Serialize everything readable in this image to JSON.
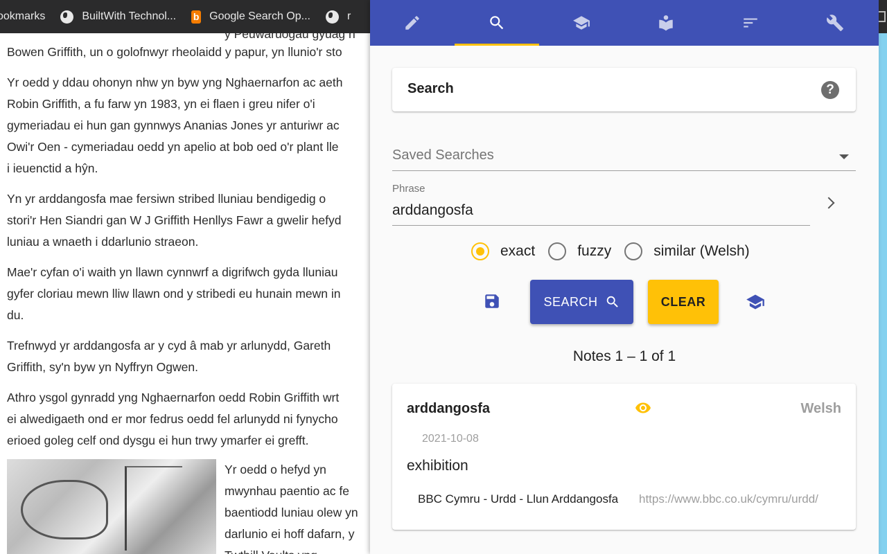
{
  "bookmarks": {
    "items": [
      {
        "label": "ookmarks",
        "icon": "bookmarks-folder"
      },
      {
        "label": "BuiltWith Technol...",
        "icon": "globe-icon"
      },
      {
        "label": "Google Search Op...",
        "icon": "bing-icon"
      },
      {
        "label": "r",
        "icon": "globe-icon"
      }
    ]
  },
  "article": {
    "cut_top": "y Peuwaruogau gyuag n",
    "paragraphs": [
      [
        "Bowen Griffith, un o golofnwyr rheolaidd y papur, yn llunio'r sto"
      ],
      [
        "Yr oedd y ddau ohonyn nhw yn byw yng Nghaernarfon ac aeth",
        "Robin Griffith, a fu farw yn 1983, yn ei flaen i greu nifer o'i",
        "gymeriadau ei hun gan gynnwys Ananias Jones yr anturiwr ac",
        "Owi'r Oen - cymeriadau oedd yn apelio at bob oed o'r plant lle",
        "i ieuenctid a hŷn."
      ],
      [
        "Yn yr arddangosfa mae fersiwn stribed lluniau bendigedig o",
        "stori'r Hen Siandri gan W J Griffith Henllys Fawr a gwelir hefyd",
        "luniau a wnaeth i ddarlunio straeon."
      ],
      [
        "Mae'r cyfan o'i waith yn llawn cynnwrf a digrifwch gyda lluniau",
        "gyfer cloriau mewn lliw llawn ond y stribedi eu hunain mewn in",
        "du."
      ],
      [
        "Trefnwyd yr arddangosfa ar y cyd â mab yr arlunydd, Gareth",
        "Griffith, sy'n byw yn Nyffryn Ogwen."
      ],
      [
        "Athro ysgol gynradd yng Nghaernarfon oedd Robin Griffith wrt",
        "ei alwedigaeth ond er mor fedrus oedd fel arlunydd ni fynycho",
        "erioed goleg celf ond dysgu ei hun trwy ymarfer ei grefft."
      ]
    ],
    "side_lines": [
      "Yr oedd o hefyd yn",
      "mwynhau paentio ac fe",
      "baentiodd luniau olew yn",
      "darlunio ei hoff dafarn, y",
      "Twthill Vaults yng"
    ]
  },
  "panel": {
    "tabs": [
      {
        "name": "tab-edit",
        "icon": "pencil-icon"
      },
      {
        "name": "tab-search",
        "icon": "search-icon",
        "active": true
      },
      {
        "name": "tab-learn",
        "icon": "school-icon"
      },
      {
        "name": "tab-read",
        "icon": "book-reader-icon"
      },
      {
        "name": "tab-sort",
        "icon": "sort-icon"
      },
      {
        "name": "tab-settings",
        "icon": "wrench-icon"
      }
    ],
    "search_card": {
      "title": "Search",
      "help": "?"
    },
    "saved_searches": {
      "label": "Saved Searches"
    },
    "phrase": {
      "label": "Phrase",
      "value": "arddangosfa"
    },
    "match_modes": [
      {
        "label": "exact",
        "selected": true
      },
      {
        "label": "fuzzy",
        "selected": false
      },
      {
        "label": "similar (Welsh)",
        "selected": false
      }
    ],
    "buttons": {
      "search": "SEARCH",
      "clear": "CLEAR"
    },
    "results_count": "Notes 1 – 1 of 1",
    "note": {
      "term": "arddangosfa",
      "language": "Welsh",
      "date": "2021-10-08",
      "translation": "exhibition",
      "source_title": "BBC Cymru - Urdd - Llun Arddangosfa",
      "source_url": "https://www.bbc.co.uk/cymru/urdd/"
    }
  },
  "colors": {
    "toolbar": "#3f51b5",
    "accent": "#ffc107",
    "bookmarks_bar": "#2b2b2c"
  }
}
